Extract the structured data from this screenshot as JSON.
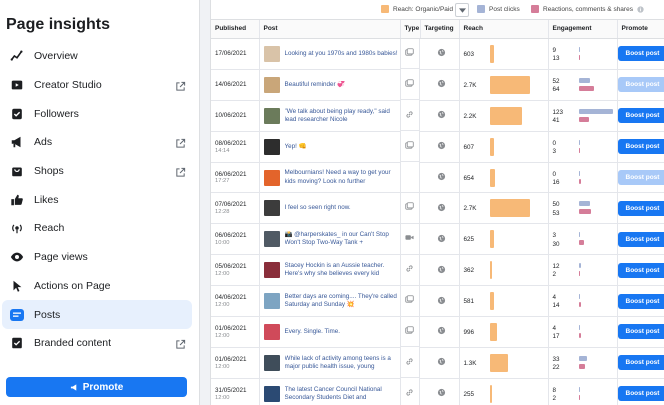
{
  "sidebar": {
    "title": "Page insights",
    "items": [
      {
        "label": "Overview",
        "icon": "overview-icon",
        "external": false,
        "active": false
      },
      {
        "label": "Creator Studio",
        "icon": "creator-studio-icon",
        "external": true,
        "active": false
      },
      {
        "label": "Followers",
        "icon": "followers-icon",
        "external": false,
        "active": false
      },
      {
        "label": "Ads",
        "icon": "megaphone-icon",
        "external": true,
        "active": false
      },
      {
        "label": "Shops",
        "icon": "shop-bag-icon",
        "external": true,
        "active": false
      },
      {
        "label": "Likes",
        "icon": "thumbs-up-icon",
        "external": false,
        "active": false
      },
      {
        "label": "Reach",
        "icon": "reach-icon",
        "external": false,
        "active": false
      },
      {
        "label": "Page views",
        "icon": "eye-icon",
        "external": false,
        "active": false
      },
      {
        "label": "Actions on Page",
        "icon": "cursor-icon",
        "external": false,
        "active": false
      },
      {
        "label": "Posts",
        "icon": "posts-icon",
        "external": false,
        "active": true
      },
      {
        "label": "Branded content",
        "icon": "branded-content-icon",
        "external": true,
        "active": false
      }
    ],
    "promote_label": "Promote"
  },
  "legend": {
    "reach": "Reach: Organic/Paid",
    "clicks": "Post clicks",
    "reactions": "Reactions, comments & shares"
  },
  "colors": {
    "reach": "#f7b977",
    "clicks": "#a5b4d6",
    "reactions": "#d57d99",
    "accent": "#1877f2"
  },
  "table": {
    "headers": [
      "Published",
      "Post",
      "Type",
      "Targeting",
      "Reach",
      "Engagement",
      "Promote"
    ],
    "boost_label": "Boost post",
    "rows": [
      {
        "date": "17/06/2021",
        "time": "",
        "text": "Looking at you 1970s and 1980s babies!",
        "type": "photo-icon",
        "reach": "603",
        "reach_frac": 0.12,
        "clicks": "9",
        "reactions": "13",
        "clicks_frac": 0.03,
        "react_frac": 0.05,
        "boost_enabled": true,
        "thumb": "#d9c3a8"
      },
      {
        "date": "14/06/2021",
        "time": "",
        "text": "Beautiful reminder 💞",
        "type": "photo-icon",
        "reach": "2.7K",
        "reach_frac": 1.0,
        "clicks": "52",
        "reactions": "64",
        "clicks_frac": 0.35,
        "react_frac": 0.45,
        "boost_enabled": false,
        "thumb": "#c9a679"
      },
      {
        "date": "10/06/2021",
        "time": "",
        "text": "\"We talk about being play ready,\" said lead researcher Nicole",
        "type": "link-icon",
        "reach": "2.2K",
        "reach_frac": 0.8,
        "clicks": "123",
        "reactions": "41",
        "clicks_frac": 1.0,
        "react_frac": 0.3,
        "boost_enabled": true,
        "thumb": "#6b7b5b"
      },
      {
        "date": "08/06/2021",
        "time": "14:14",
        "text": "Yep! 👊",
        "type": "photo-icon",
        "reach": "607",
        "reach_frac": 0.12,
        "clicks": "0",
        "reactions": "3",
        "clicks_frac": 0.0,
        "react_frac": 0.02,
        "boost_enabled": true,
        "thumb": "#2d2d2d"
      },
      {
        "date": "06/06/2021",
        "time": "17:27",
        "text": "Melbournians! Need a way to get your kids moving? Look no further",
        "type": "",
        "reach": "654",
        "reach_frac": 0.13,
        "clicks": "0",
        "reactions": "16",
        "clicks_frac": 0.0,
        "react_frac": 0.07,
        "boost_enabled": false,
        "thumb": "#e3642b"
      },
      {
        "date": "07/06/2021",
        "time": "12:28",
        "text": "I feel so seen right now.",
        "type": "photo-icon",
        "reach": "2.7K",
        "reach_frac": 1.0,
        "clicks": "50",
        "reactions": "53",
        "clicks_frac": 0.34,
        "react_frac": 0.38,
        "boost_enabled": true,
        "thumb": "#3c3c3c"
      },
      {
        "date": "06/06/2021",
        "time": "10:00",
        "text": "📸 @harperskates_ in our Can't Stop Won't Stop Two-Way Tank +",
        "type": "video-icon",
        "reach": "625",
        "reach_frac": 0.12,
        "clicks": "3",
        "reactions": "30",
        "clicks_frac": 0.02,
        "react_frac": 0.15,
        "boost_enabled": true,
        "thumb": "#505a64"
      },
      {
        "date": "05/06/2021",
        "time": "12:00",
        "text": "Stacey Hockin is an Aussie teacher. Here's why she believes every kid",
        "type": "link-icon",
        "reach": "362",
        "reach_frac": 0.07,
        "clicks": "12",
        "reactions": "2",
        "clicks_frac": 0.07,
        "react_frac": 0.02,
        "boost_enabled": true,
        "thumb": "#8a2e3b"
      },
      {
        "date": "04/06/2021",
        "time": "12:00",
        "text": "Better days are coming.... They're called Saturday and Sunday 💥",
        "type": "photo-icon",
        "reach": "581",
        "reach_frac": 0.11,
        "clicks": "4",
        "reactions": "14",
        "clicks_frac": 0.03,
        "react_frac": 0.06,
        "boost_enabled": true,
        "thumb": "#7da4c2"
      },
      {
        "date": "01/06/2021",
        "time": "12:00",
        "text": "Every. Single. Time.",
        "type": "photo-icon",
        "reach": "996",
        "reach_frac": 0.19,
        "clicks": "4",
        "reactions": "17",
        "clicks_frac": 0.03,
        "react_frac": 0.08,
        "boost_enabled": true,
        "thumb": "#d04a5a"
      },
      {
        "date": "01/06/2021",
        "time": "12:00",
        "text": "While lack of activity among teens is a major public health issue, young",
        "type": "link-icon",
        "reach": "1.3K",
        "reach_frac": 0.45,
        "clicks": "33",
        "reactions": "22",
        "clicks_frac": 0.25,
        "react_frac": 0.18,
        "boost_enabled": true,
        "thumb": "#3f4d5a"
      },
      {
        "date": "31/05/2021",
        "time": "12:00",
        "text": "The latest Cancer Council National Secondary Students Diet and",
        "type": "link-icon",
        "reach": "255",
        "reach_frac": 0.05,
        "clicks": "8",
        "reactions": "2",
        "clicks_frac": 0.05,
        "react_frac": 0.02,
        "boost_enabled": true,
        "thumb": "#2b4a73"
      }
    ]
  }
}
